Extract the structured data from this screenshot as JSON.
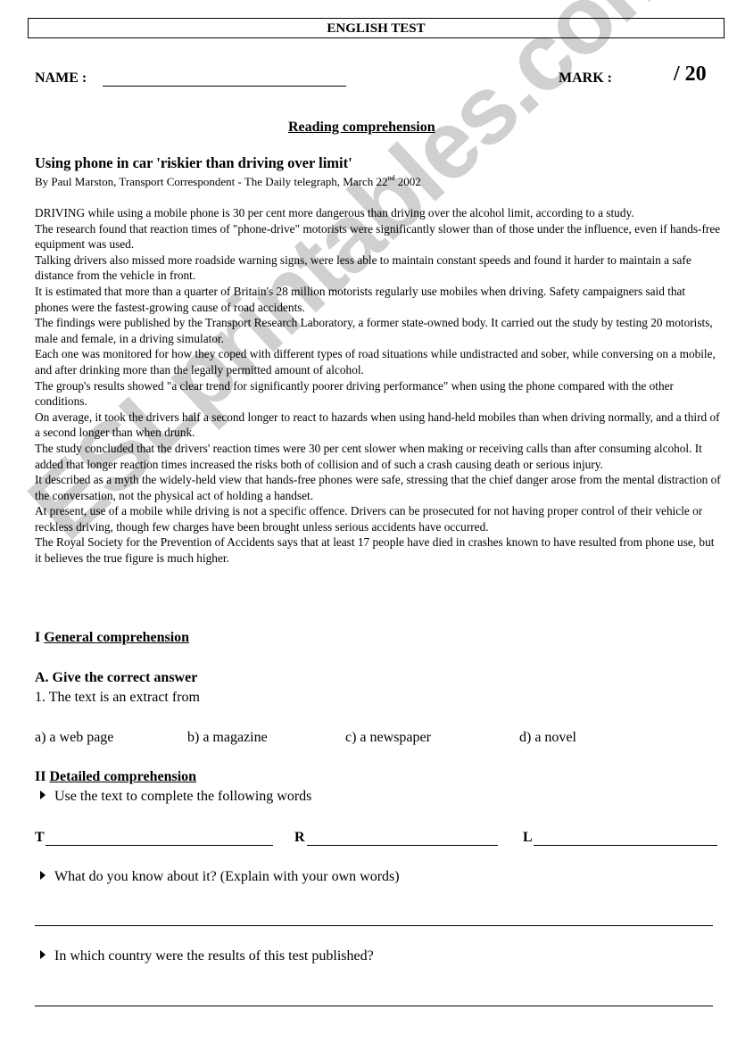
{
  "header": {
    "title": "ENGLISH TEST",
    "name_label": "NAME :",
    "mark_label": "MARK :",
    "score_total": "/  20"
  },
  "reading": {
    "section_title": "Reading comprehension",
    "headline": "Using phone in car 'riskier than driving over limit'",
    "byline_prefix": "By Paul Marston, Transport Correspondent - The Daily telegraph, March 22",
    "byline_sup": "nd",
    "byline_suffix": " 2002",
    "paragraphs": [
      "DRIVING while using a mobile phone is 30 per cent more dangerous than driving over the alcohol limit, according to a study.",
      "The research found that reaction times of \"phone-drive\" motorists were significantly slower than of those under the influence, even if hands-free equipment was used.",
      "Talking drivers also missed more roadside warning signs, were less able to maintain constant speeds and found it harder to maintain a safe distance from the vehicle in front.",
      "It is estimated that more than a quarter of Britain's 28 million motorists regularly use mobiles when driving. Safety campaigners said that phones were the fastest-growing cause of road accidents.",
      "The findings were published by the Transport Research Laboratory, a former state-owned body. It carried out the study by testing 20 motorists, male and female, in a driving simulator.",
      "Each one was monitored for how they coped with different types of road situations while undistracted and sober, while conversing on a mobile, and after drinking more than the legally permitted amount of alcohol.",
      "The group's results showed \"a clear trend for significantly poorer driving performance\" when using the phone compared with the other conditions.",
      "On average, it took the drivers half a second longer to react to hazards when using hand-held mobiles than when driving normally, and a third of a second longer than when drunk.",
      "The study concluded that the drivers' reaction times were 30 per cent slower when making or receiving calls than after consuming alcohol. It added that longer reaction times increased the risks both of collision and of such a crash causing death or serious injury.",
      "It described as a myth the widely-held view that hands-free phones were safe, stressing that the chief danger arose from the mental distraction of the conversation, not the physical act of holding a handset.",
      "At present, use of a mobile while driving is not a specific offence. Drivers can be prosecuted for not having proper control of their vehicle or reckless driving, though few charges have been brought unless serious accidents have occurred.",
      "The Royal Society for the Prevention of Accidents says that at least 17 people have died in crashes known to have resulted from phone use, but it believes the true figure is much higher."
    ]
  },
  "general": {
    "numeral": "I",
    "title": "General comprehension",
    "part_a": "A. Give the correct answer",
    "question_1": "1. The text is an extract from",
    "options": [
      "a) a web page",
      "b) a magazine",
      "c) a newspaper",
      "d) a novel"
    ]
  },
  "detailed": {
    "numeral": "II",
    "title": "Detailed comprehension",
    "instruction_1": "Use the text to complete the following words",
    "word_letters": [
      "T",
      "R",
      "L"
    ],
    "instruction_2": "What do you know about it? (Explain with your own words)",
    "instruction_3": "In which country were the results of this test published?"
  },
  "watermark": {
    "text": "ESLprintables.com",
    "color": "#c8c8c8"
  }
}
